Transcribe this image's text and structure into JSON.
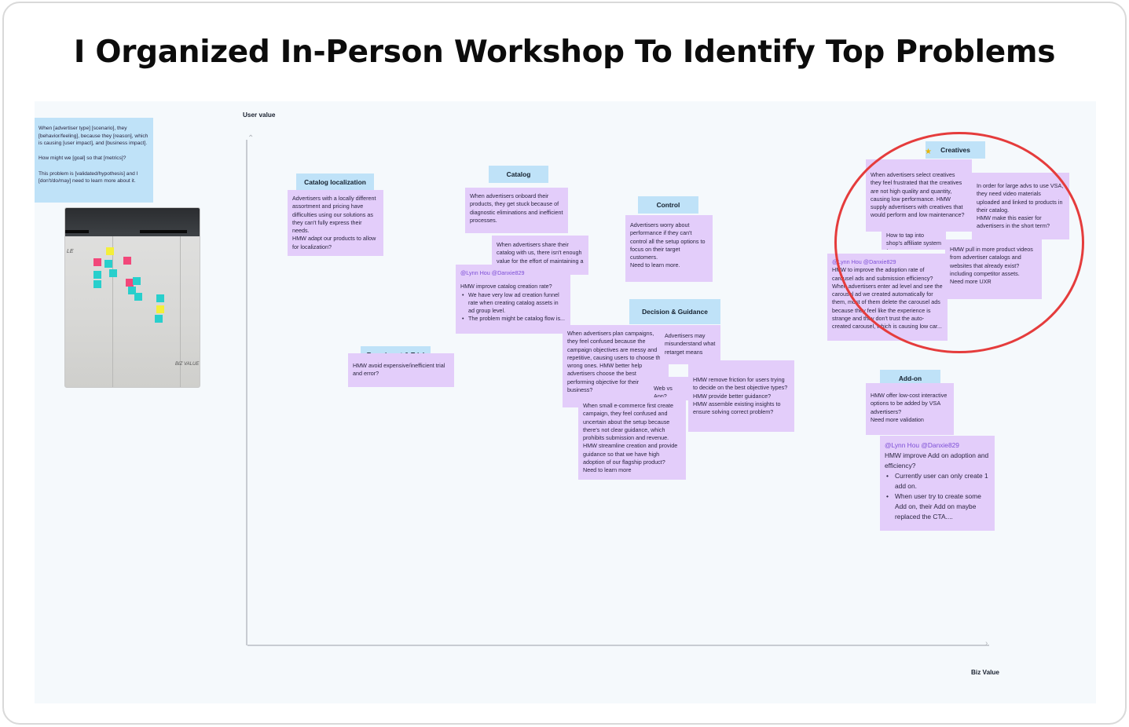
{
  "page_title": "I Organized In-Person Workshop To Identify Top Problems",
  "axes": {
    "y_label": "User value",
    "x_label": "Biz Value"
  },
  "template_note": "When [advertiser type] [scenario], they [behavior/feeling], because they [reason], which is causing [user impact], and [business impact].\n\nHow might we [goal] so that [metrics]?\n\nThis problem is [validated/hypothesis] and I [don't/do/may] need to learn more about it.",
  "photo": {
    "wall_text_left": "LE",
    "wall_text_bottom": "BIZ VALUE"
  },
  "labels": {
    "catalog_localization": "Catalog localization",
    "catalog": "Catalog",
    "control": "Control",
    "experiment_trial": "Experiment & Trial",
    "decision_guidance": "Decision & Guidance",
    "creatives": "Creatives",
    "add_on": "Add-on"
  },
  "notes": {
    "catalog_localization": "Advertisers with a locally different assortment and pricing have difficulties using our solutions as they can't fully express their needs.\nHMW adapt our products to allow for localization?",
    "catalog_1": "When advertisers onboard their products, they get stuck because of diagnostic eliminations and inefficient processes.",
    "catalog_2": "When advertisers share their catalog with us, there isn't enough value for the effort of maintaining a catalog.",
    "catalog_3": {
      "mention": "@Lynn Hou @Danxie829",
      "text": "HMW improve catalog creation rate?",
      "bullets": [
        "We have very low ad creation funnel rate when creating catalog assets in ad group level.",
        "The problem might be catalog flow is..."
      ]
    },
    "control": "Advertisers worry about performance if they can't control all the setup options to focus on their target customers.\nNeed to learn more.",
    "experiment_trial": "HMW avoid expensive/inefficient trial and error?",
    "decision_1": "When advertisers plan campaigns, they feel confused because the campaign objectives are messy and repetitive, causing users to choose the wrong ones. HMW better help advertisers choose the best performing objective for their business?",
    "decision_2": "Advertisers may misunderstand what retarget means",
    "decision_3": "Web vs App?",
    "decision_4": "HMW remove friction for users trying to decide on the best objective types?\nHMW provide better guidance?\nHMW assemble existing insights to ensure solving correct problem?",
    "decision_5": "When small e-commerce first create campaign, they feel confused and uncertain about the setup because there's not clear guidance, which prohibits submission and revenue.\nHMW streamline creation and provide guidance so that we have high adoption of our flagship product?\nNeed to learn more",
    "creatives_1": "When advertisers select creatives they feel frustrated that the creatives are not high quality and quantity, causing low performance. HMW supply advertisers with creatives that would perform and low maintenance?",
    "creatives_2": "In order for large advs to use VSA, they need video materials uploaded and linked to products in their catalog.\nHMW make this easier for advertisers in the short term?",
    "creatives_3": "How to tap into shop's affiliate system for OLE?",
    "creatives_4": {
      "mention": "@Lynn Hou @Danxie829",
      "text": "HMW to improve the adoption rate of carousel ads and submission efficiency?\nWhen advertisers enter ad level and see the carousel ad we created automatically for them, most of them delete the carousel ads because they feel like the experience is strange and they don't trust the auto-created carousel, which is causing low car..."
    },
    "creatives_5": "HMW pull in more product videos from advertiser catalogs and websites that already exist? including competitor assets.\nNeed more UXR",
    "addon_1": "HMW offer low-cost interactive options to be added by VSA advertisers?\nNeed more validation",
    "addon_2": {
      "mention": "@Lynn Hou @Danxie829",
      "text": "HMW improve Add on adoption and efficiency?",
      "bullets": [
        "Currently user can only create 1 add on.",
        "When user try to create some Add on, their Add on maybe replaced the CTA...."
      ]
    }
  },
  "colors": {
    "note_purple": "#e3cdfa",
    "label_blue": "#bfe2f8",
    "highlight_circle": "#e53c3c",
    "board_bg": "#f5f9fc"
  }
}
